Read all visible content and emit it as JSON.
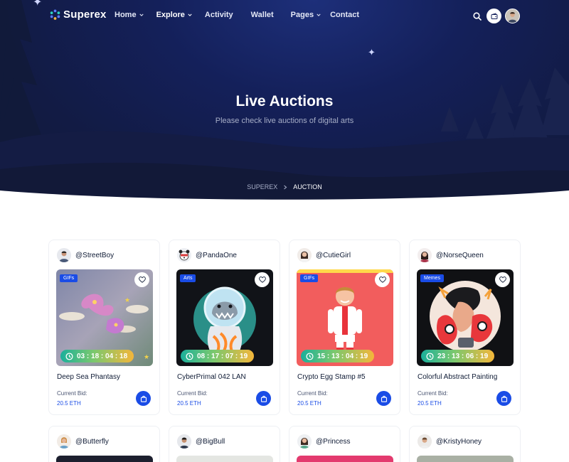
{
  "brand": {
    "name": "Superex"
  },
  "nav": {
    "items": [
      {
        "label": "Home",
        "dropdown": true,
        "active": false
      },
      {
        "label": "Explore",
        "dropdown": true,
        "active": true
      },
      {
        "label": "Activity",
        "dropdown": false,
        "active": false
      },
      {
        "label": "Wallet",
        "dropdown": false,
        "active": false
      },
      {
        "label": "Pages",
        "dropdown": true,
        "active": false
      },
      {
        "label": "Contact",
        "dropdown": false,
        "active": false
      }
    ],
    "icons": [
      "search-icon",
      "wallet-icon",
      "user-avatar"
    ]
  },
  "hero": {
    "title": "Live Auctions",
    "subtitle": "Please check live auctions of digital arts",
    "breadcrumb": {
      "home": "SUPEREX",
      "current": "AUCTION"
    }
  },
  "colors": {
    "primary": "#1a4ce6",
    "hero_bg": "#14205a",
    "text_dark": "#0f1b35"
  },
  "cards": [
    {
      "user": "@StreetBoy",
      "category": "GIFs",
      "timer": "03 : 18 : 04 : 18",
      "title": "Deep Sea Phantasy",
      "bid_label": "Current Bid:",
      "bid_value": "20.5 ETH"
    },
    {
      "user": "@PandaOne",
      "category": "Arts",
      "timer": "08 : 17 : 07 : 19",
      "title": "CyberPrimal 042 LAN",
      "bid_label": "Current Bid:",
      "bid_value": "20.5 ETH"
    },
    {
      "user": "@CutieGirl",
      "category": "GIFs",
      "timer": "15 : 13 : 04 : 19",
      "title": "Crypto Egg Stamp #5",
      "bid_label": "Current Bid:",
      "bid_value": "20.5 ETH"
    },
    {
      "user": "@NorseQueen",
      "category": "Memes",
      "timer": "23 : 13 : 06 : 19",
      "title": "Colorful Abstract Painting",
      "bid_label": "Current Bid:",
      "bid_value": "20.5 ETH"
    }
  ],
  "cards_row2": [
    {
      "user": "@Butterfly"
    },
    {
      "user": "@BigBull"
    },
    {
      "user": "@Princess"
    },
    {
      "user": "@KristyHoney"
    }
  ]
}
